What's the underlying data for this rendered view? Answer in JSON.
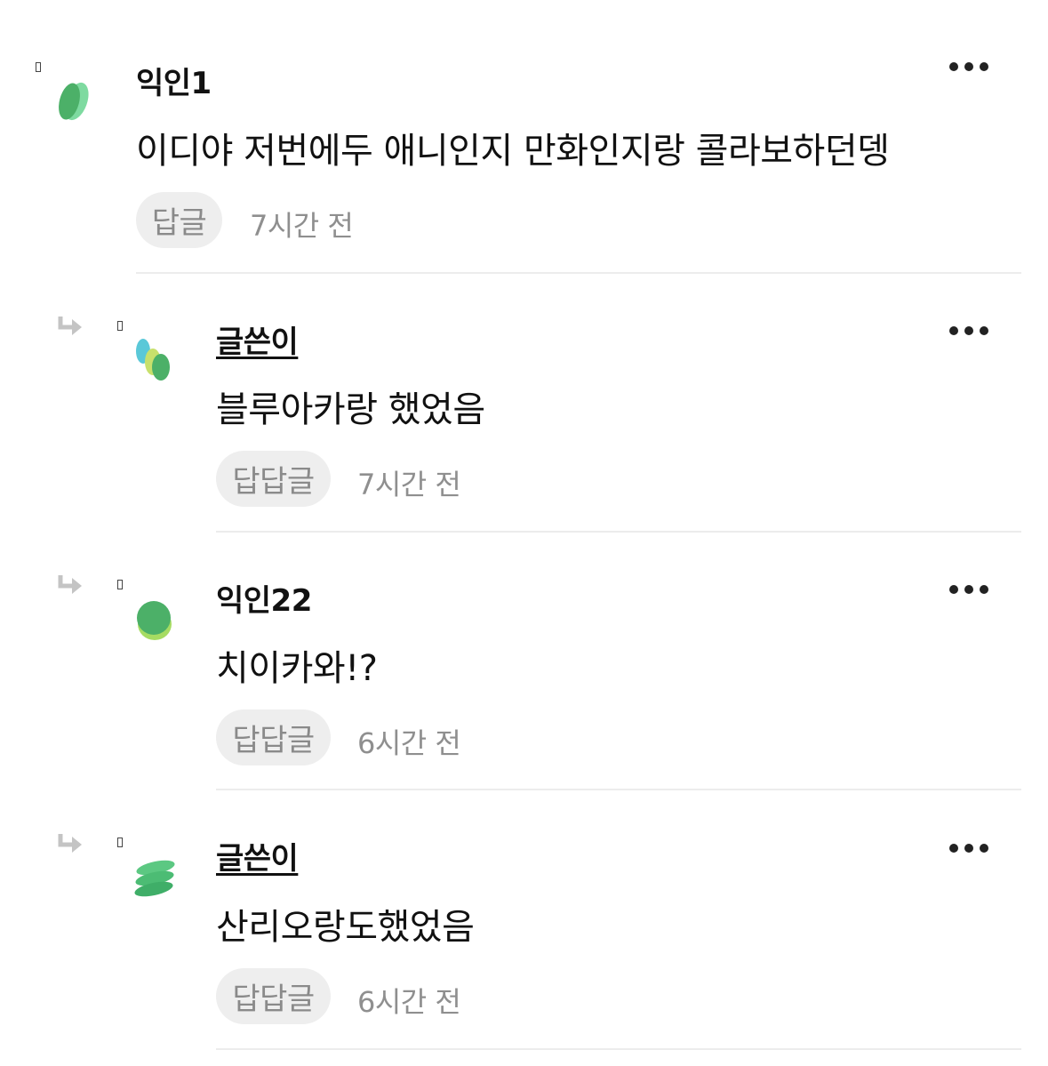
{
  "comments": [
    {
      "author": "익인1",
      "text": "이디야 저번에두 애니인지 만화인지랑 콜라보하던뎅",
      "reply_label": "답글",
      "time": "7시간 전",
      "is_reply": false,
      "is_op": false,
      "avatar_icon": "green-leaf-avatar-icon"
    },
    {
      "author": "글쓴이",
      "text": "블루아카랑 했었음",
      "reply_label": "답답글",
      "time": "7시간 전",
      "is_reply": true,
      "is_op": true,
      "avatar_icon": "multicolor-bubbles-avatar-icon"
    },
    {
      "author": "익인22",
      "text": "치이카와!?",
      "reply_label": "답답글",
      "time": "6시간 전",
      "is_reply": true,
      "is_op": false,
      "avatar_icon": "green-stacked-ovals-avatar-icon"
    },
    {
      "author": "글쓴이",
      "text": "산리오랑도했었음",
      "reply_label": "답답글",
      "time": "6시간 전",
      "is_reply": true,
      "is_op": true,
      "avatar_icon": "green-layered-discs-avatar-icon"
    }
  ],
  "colors": {
    "accent_green": "#4cbc74",
    "divider": "#ececec",
    "button_bg": "#eeeeee",
    "muted_text": "#8f8f8f"
  }
}
